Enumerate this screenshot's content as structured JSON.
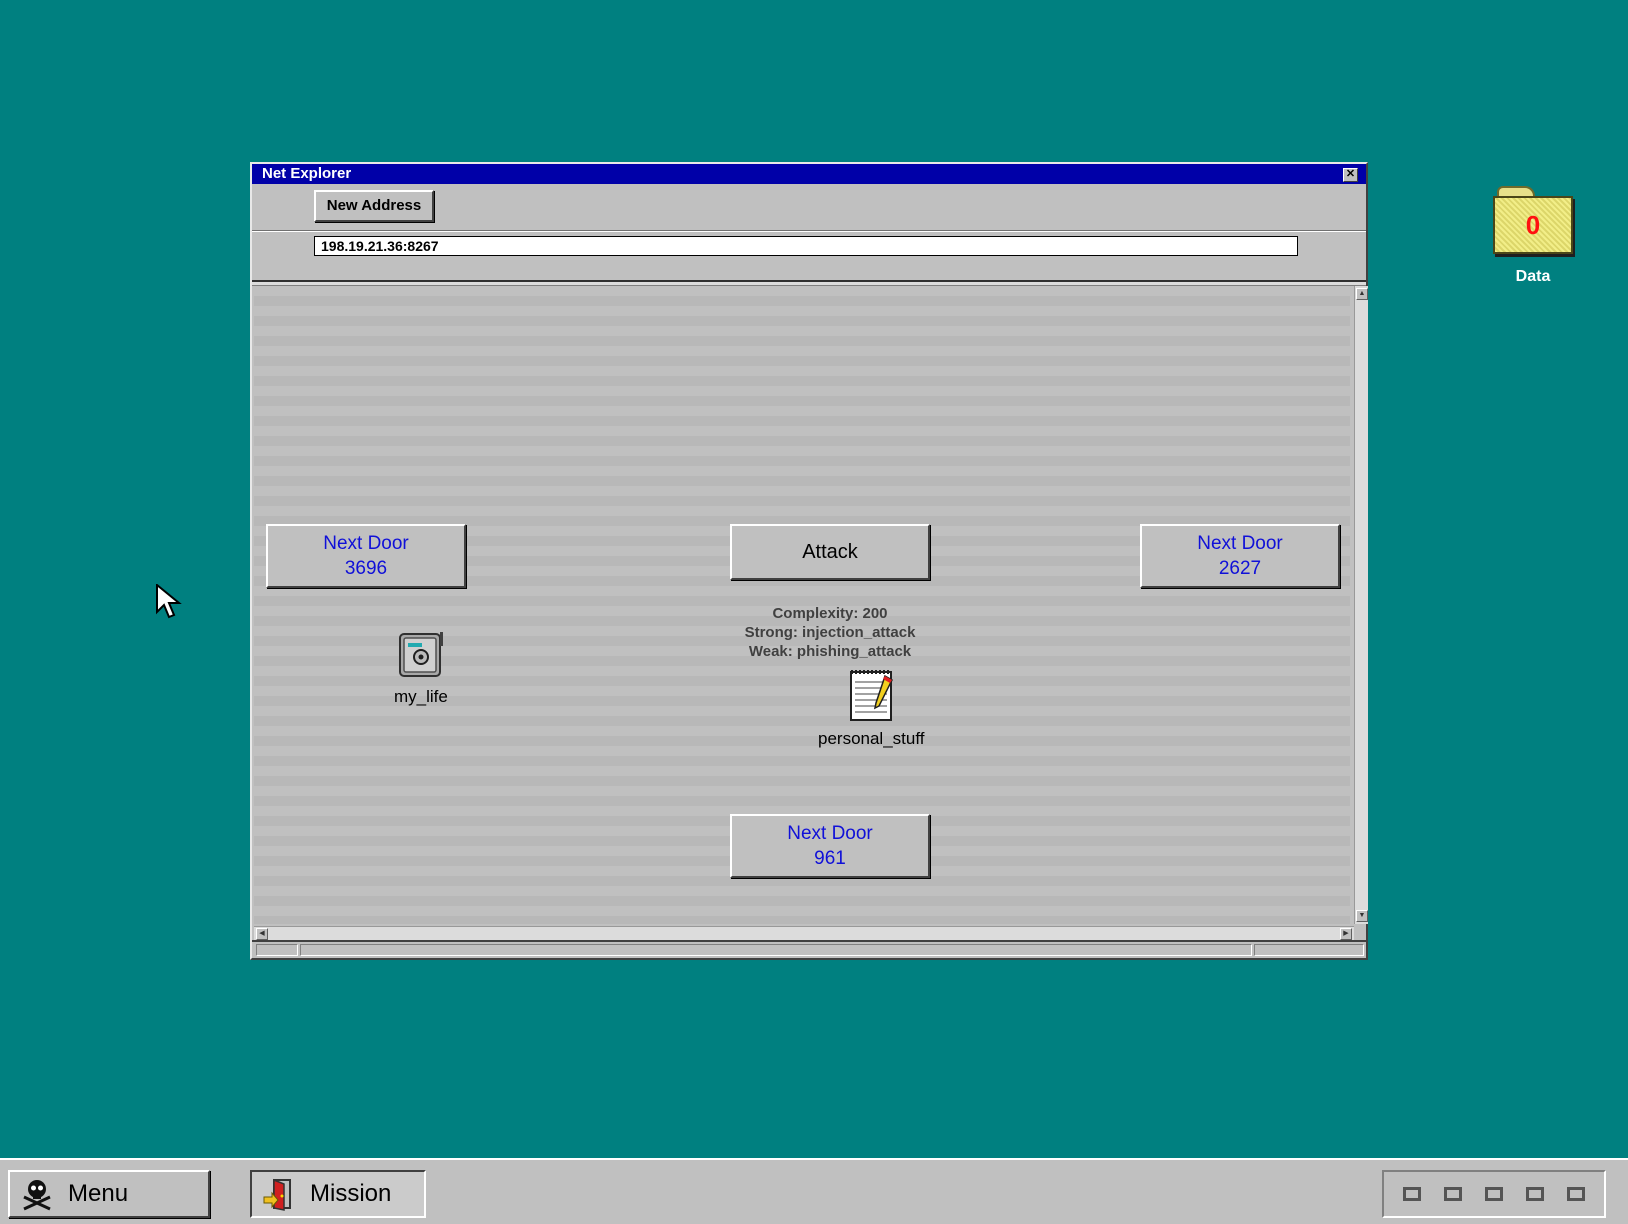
{
  "desktop": {
    "data_folder": {
      "label": "Data",
      "count": "0"
    }
  },
  "window": {
    "title": "Net Explorer",
    "new_address_label": "New Address",
    "address_value": "198.19.21.36:8267",
    "doors": [
      {
        "label": "Next Door",
        "number": "3696"
      },
      {
        "label": "Next Door",
        "number": "2627"
      },
      {
        "label": "Next Door",
        "number": "961"
      }
    ],
    "attack_label": "Attack",
    "target_info": {
      "complexity": "Complexity: 200",
      "strong": "Strong: injection_attack",
      "weak": "Weak: phishing_attack"
    },
    "files": [
      {
        "name": "my_life",
        "icon": "safe-icon"
      },
      {
        "name": "personal_stuff",
        "icon": "notepad-icon"
      }
    ]
  },
  "taskbar": {
    "menu_label": "Menu",
    "mission_label": "Mission",
    "tray_slots": 5
  }
}
